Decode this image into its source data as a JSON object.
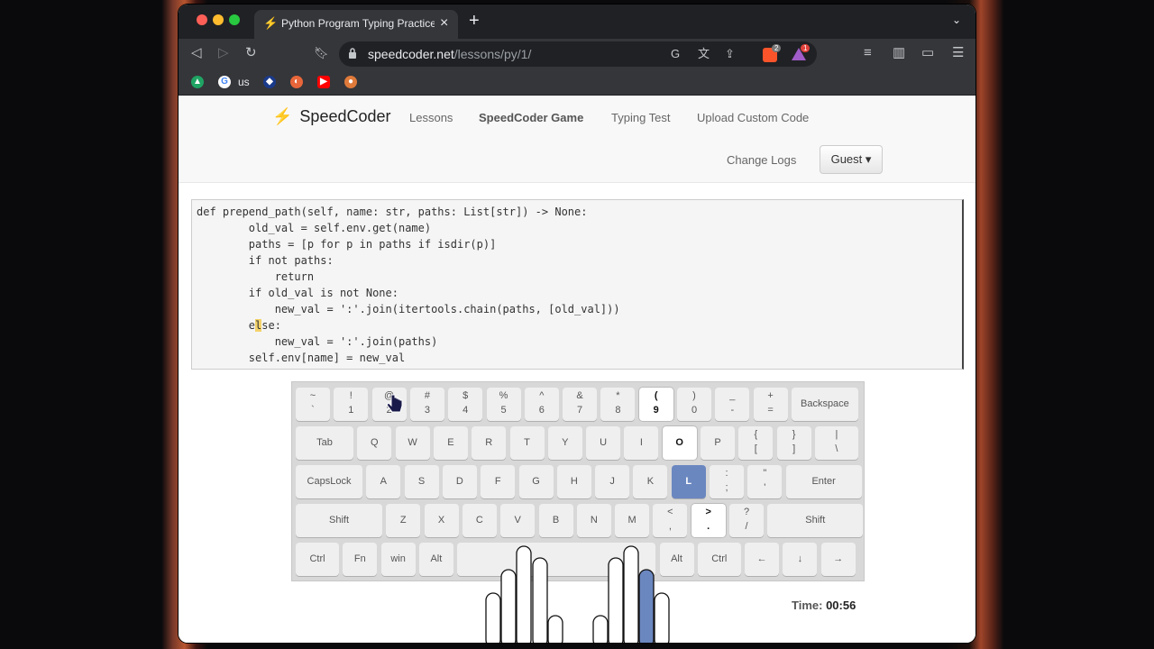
{
  "browser": {
    "tab_title": "Python Program Typing Practice",
    "url_domain": "speedcoder.net",
    "url_path": "/lessons/py/1/",
    "bookmark_label": "us",
    "brave_badge": "2",
    "alert_badge": "1"
  },
  "site": {
    "brand": "SpeedCoder",
    "nav": [
      "Lessons",
      "SpeedCoder Game",
      "Typing Test",
      "Upload Custom Code"
    ],
    "change_logs": "Change Logs",
    "guest": "Guest"
  },
  "code_lines": [
    "def prepend_path(self, name: str, paths: List[str]) -> None:",
    "        old_val = self.env.get(name)",
    "        paths = [p for p in paths if isdir(p)]",
    "        if not paths:",
    "            return",
    "        if old_val is not None:",
    "            new_val = ':'.join(itertools.chain(paths, [old_val]))",
    "        el",
    "            new_val = ':'.join(paths)",
    "        self.env[name] = new_val"
  ],
  "cursor": {
    "before": "        e",
    "char": "l",
    "after": "se:"
  },
  "keyboard": {
    "row1": [
      [
        "~",
        "`"
      ],
      [
        "!",
        "1"
      ],
      [
        "@",
        "2"
      ],
      [
        "#",
        "3"
      ],
      [
        "$",
        "4"
      ],
      [
        "%",
        "5"
      ],
      [
        "^",
        "6"
      ],
      [
        "&",
        "7"
      ],
      [
        "*",
        "8"
      ],
      [
        "(",
        "9"
      ],
      [
        ")",
        "0"
      ],
      [
        "_",
        "-"
      ],
      [
        "+",
        "="
      ],
      [
        "Backspace"
      ]
    ],
    "row2": [
      [
        "Tab"
      ],
      [
        "Q"
      ],
      [
        "W"
      ],
      [
        "E"
      ],
      [
        "R"
      ],
      [
        "T"
      ],
      [
        "Y"
      ],
      [
        "U"
      ],
      [
        "I"
      ],
      [
        "O"
      ],
      [
        "P"
      ],
      [
        "{",
        "["
      ],
      [
        "}",
        "]"
      ],
      [
        "|",
        "\\"
      ]
    ],
    "row3": [
      [
        "CapsLock"
      ],
      [
        "A"
      ],
      [
        "S"
      ],
      [
        "D"
      ],
      [
        "F"
      ],
      [
        "G"
      ],
      [
        "H"
      ],
      [
        "J"
      ],
      [
        "K"
      ],
      [
        "L"
      ],
      [
        ":",
        ";"
      ],
      [
        "\"",
        "'"
      ],
      [
        "Enter"
      ]
    ],
    "row4": [
      [
        "Shift"
      ],
      [
        "Z"
      ],
      [
        "X"
      ],
      [
        "C"
      ],
      [
        "V"
      ],
      [
        "B"
      ],
      [
        "N"
      ],
      [
        "M"
      ],
      [
        "<",
        ","
      ],
      [
        ">",
        "."
      ],
      [
        "?",
        "/"
      ],
      [
        "Shift"
      ]
    ],
    "row5": [
      [
        "Ctrl"
      ],
      [
        "Fn"
      ],
      [
        "win"
      ],
      [
        "Alt"
      ],
      [
        ""
      ],
      [
        "Alt"
      ],
      [
        "Ctrl"
      ],
      [
        "←"
      ],
      [
        "↓"
      ],
      [
        "→"
      ]
    ]
  },
  "time": {
    "label": "Time:",
    "value": "00:56"
  },
  "colors": {
    "highlight": "#6b87c0",
    "cursor": "#f3d26a"
  }
}
